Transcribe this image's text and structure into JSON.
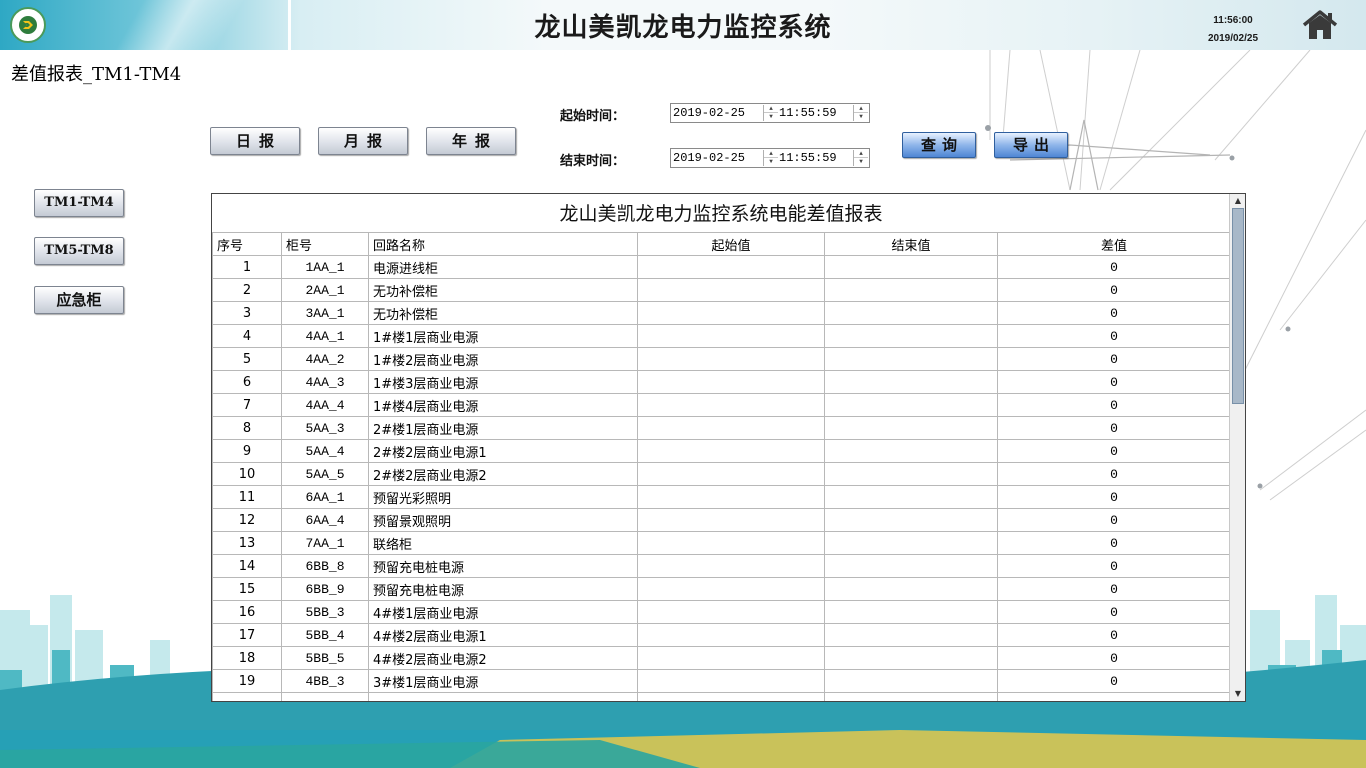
{
  "header": {
    "title": "龙山美凯龙电力监控系统",
    "time": "11:56:00",
    "date": "2019/02/25"
  },
  "page_title": "差值报表_TM1-TM4",
  "report_buttons": {
    "daily": "日报",
    "monthly": "月报",
    "yearly": "年报"
  },
  "side_buttons": {
    "tm1_tm4": "TM1-TM4",
    "tm5_tm8": "TM5-TM8",
    "emergency": "应急柜"
  },
  "query": {
    "start_label": "起始时间：",
    "end_label": "结束时间：",
    "start_date": "2019-02-25",
    "start_time": "11:55:59",
    "end_date": "2019-02-25",
    "end_time": "11:55:59",
    "query_btn": "查询",
    "export_btn": "导出"
  },
  "table": {
    "title": "龙山美凯龙电力监控系统电能差值报表",
    "headers": [
      "序号",
      "柜号",
      "回路名称",
      "起始值",
      "结束值",
      "差值"
    ],
    "rows": [
      [
        "1",
        "1AA_1",
        "电源进线柜",
        "",
        "",
        "0"
      ],
      [
        "2",
        "2AA_1",
        "无功补偿柜",
        "",
        "",
        "0"
      ],
      [
        "3",
        "3AA_1",
        "无功补偿柜",
        "",
        "",
        "0"
      ],
      [
        "4",
        "4AA_1",
        "1#楼1层商业电源",
        "",
        "",
        "0"
      ],
      [
        "5",
        "4AA_2",
        "1#楼2层商业电源",
        "",
        "",
        "0"
      ],
      [
        "6",
        "4AA_3",
        "1#楼3层商业电源",
        "",
        "",
        "0"
      ],
      [
        "7",
        "4AA_4",
        "1#楼4层商业电源",
        "",
        "",
        "0"
      ],
      [
        "8",
        "5AA_3",
        "2#楼1层商业电源",
        "",
        "",
        "0"
      ],
      [
        "9",
        "5AA_4",
        "2#楼2层商业电源1",
        "",
        "",
        "0"
      ],
      [
        "10",
        "5AA_5",
        "2#楼2层商业电源2",
        "",
        "",
        "0"
      ],
      [
        "11",
        "6AA_1",
        "预留光彩照明",
        "",
        "",
        "0"
      ],
      [
        "12",
        "6AA_4",
        "预留景观照明",
        "",
        "",
        "0"
      ],
      [
        "13",
        "7AA_1",
        "联络柜",
        "",
        "",
        "0"
      ],
      [
        "14",
        "6BB_8",
        "预留充电桩电源",
        "",
        "",
        "0"
      ],
      [
        "15",
        "6BB_9",
        "预留充电桩电源",
        "",
        "",
        "0"
      ],
      [
        "16",
        "5BB_3",
        "4#楼1层商业电源",
        "",
        "",
        "0"
      ],
      [
        "17",
        "5BB_4",
        "4#楼2层商业电源1",
        "",
        "",
        "0"
      ],
      [
        "18",
        "5BB_5",
        "4#楼2层商业电源2",
        "",
        "",
        "0"
      ],
      [
        "19",
        "4BB_3",
        "3#楼1层商业电源",
        "",
        "",
        "0"
      ]
    ]
  }
}
